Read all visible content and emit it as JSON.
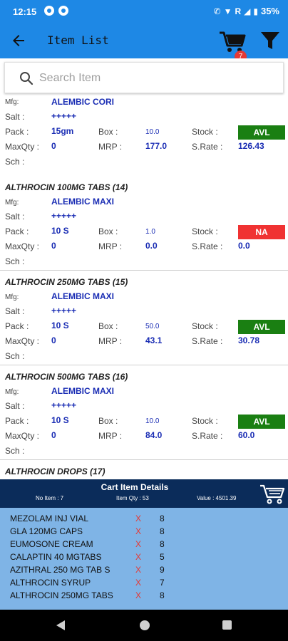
{
  "status_bar": {
    "time": "12:15",
    "network": "R",
    "battery": "35%"
  },
  "app_bar": {
    "title": "Item List",
    "cart_count": "7"
  },
  "search": {
    "placeholder": "Search Item",
    "value": ""
  },
  "labels": {
    "mfg": "Mfg:",
    "salt": "Salt :",
    "pack": "Pack :",
    "box": "Box :",
    "stock": "Stock :",
    "maxqty": "MaxQty :",
    "mrp": "MRP :",
    "srate": "S.Rate :",
    "sch": "Sch :"
  },
  "items": [
    {
      "name": "",
      "mfg": "ALEMBIC CORI",
      "salt": "+++++",
      "pack": "15gm",
      "box": "10.0",
      "stock": "AVL",
      "maxqty": "0",
      "mrp": "177.0",
      "srate": "126.43",
      "sch": ""
    },
    {
      "name": "ALTHROCIN 100MG TABS (14)",
      "mfg": "ALEMBIC MAXI",
      "salt": "+++++",
      "pack": "10 S",
      "box": "1.0",
      "stock": "NA",
      "maxqty": "0",
      "mrp": "0.0",
      "srate": "0.0",
      "sch": ""
    },
    {
      "name": "ALTHROCIN 250MG TABS (15)",
      "mfg": "ALEMBIC MAXI",
      "salt": "+++++",
      "pack": "10 S",
      "box": "50.0",
      "stock": "AVL",
      "maxqty": "0",
      "mrp": "43.1",
      "srate": "30.78",
      "sch": ""
    },
    {
      "name": "ALTHROCIN 500MG TABS (16)",
      "mfg": "ALEMBIC MAXI",
      "salt": "+++++",
      "pack": "10 S",
      "box": "10.0",
      "stock": "AVL",
      "maxqty": "0",
      "mrp": "84.0",
      "srate": "60.0",
      "sch": ""
    },
    {
      "name": "ALTHROCIN DROPS (17)",
      "mfg": "",
      "salt": "",
      "pack": "",
      "box": "",
      "stock": "",
      "maxqty": "",
      "mrp": "",
      "srate": "",
      "sch": ""
    }
  ],
  "colors": {
    "avl": "#1a7f12",
    "na": "#f03232",
    "primary": "#1e88e5",
    "cart_header": "#0b2c5a",
    "cart_body": "#7fb4e6"
  },
  "cart": {
    "title": "Cart Item Details",
    "no_item": "No Item : 7",
    "item_qty": "Item Qty : 53",
    "value": "Value : 4501.39",
    "items": [
      {
        "name": "MEZOLAM INJ VIAL",
        "x": "X",
        "qty": "8"
      },
      {
        "name": "GLA 120MG CAPS",
        "x": "X",
        "qty": "8"
      },
      {
        "name": "EUMOSONE CREAM",
        "x": "X",
        "qty": "8"
      },
      {
        "name": "CALAPTIN 40 MGTABS",
        "x": "X",
        "qty": "5"
      },
      {
        "name": "AZITHRAL 250 MG TAB S",
        "x": "X",
        "qty": "9"
      },
      {
        "name": "ALTHROCIN SYRUP",
        "x": "X",
        "qty": "7"
      },
      {
        "name": "ALTHROCIN 250MG TABS",
        "x": "X",
        "qty": "8"
      }
    ]
  },
  "icons": {
    "back": "arrow-left-icon",
    "cart": "shopping-cart-icon",
    "filter": "filter-icon",
    "search": "search-icon",
    "cart_big": "shopping-cart-icon"
  }
}
